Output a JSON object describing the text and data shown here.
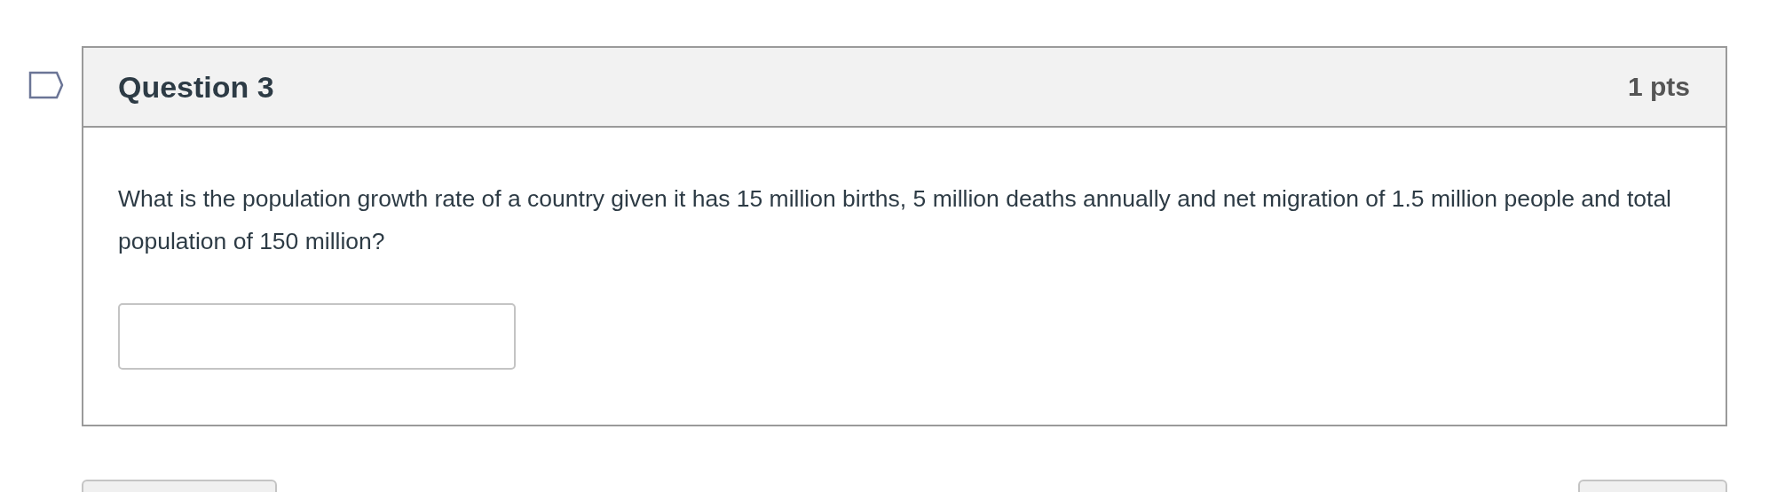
{
  "question": {
    "title": "Question 3",
    "points": "1 pts",
    "text": "What is the population growth rate of a country given it has 15 million births, 5 million deaths annually and net migration of 1.5 million people and total population of 150 million?"
  },
  "buttons": [
    {
      "kind": "left"
    },
    {
      "kind": "right"
    }
  ]
}
